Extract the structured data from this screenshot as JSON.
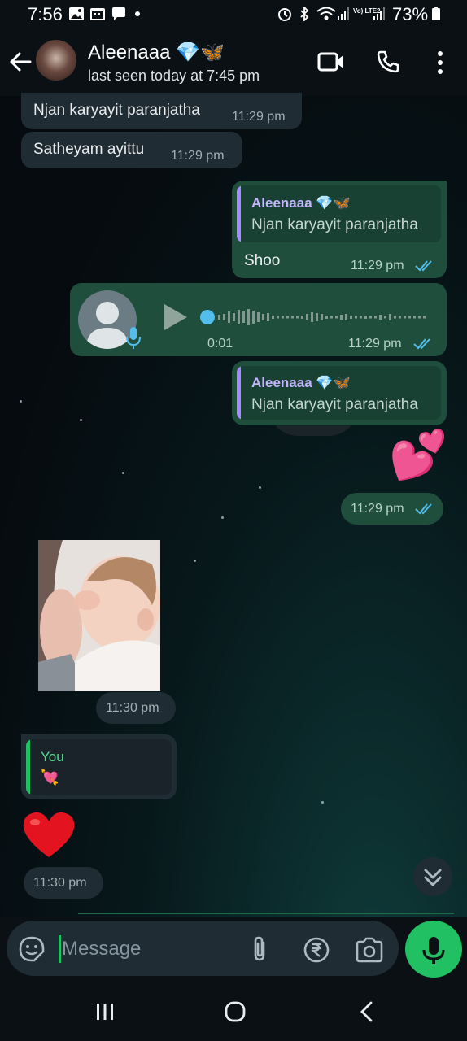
{
  "status_bar": {
    "time": "7:56",
    "network_label": "Vo) LTE2",
    "battery": "73%"
  },
  "header": {
    "contact_name": "Aleenaaa 💎🦋",
    "last_seen": "last seen today at 7:45 pm"
  },
  "messages": {
    "m1": {
      "text": "Njan karyayit paranjatha",
      "time": "11:29 pm"
    },
    "m2": {
      "text": "Satheyam ayittu",
      "time": "11:29 pm"
    },
    "m3": {
      "quote_author": "Aleenaaa 💎🦋",
      "quote_text": "Njan karyayit paranjatha",
      "text": "Shoo",
      "time": "11:29 pm"
    },
    "m4": {
      "duration": "0:01",
      "time": "11:29 pm"
    },
    "m5": {
      "quote_author": "Aleenaaa 💎🦋",
      "quote_text": "Njan karyayit paranjatha"
    },
    "m6": {
      "sticker": "💕",
      "time": "11:29 pm"
    },
    "m7": {
      "time": "11:30 pm"
    },
    "m8": {
      "quote_author": "You",
      "quote_text": "💘"
    },
    "m9": {
      "emoji": "❤️",
      "time": "11:30 pm"
    }
  },
  "input": {
    "placeholder": "Message"
  },
  "colors": {
    "accent": "#21c063",
    "outgoing_bubble": "#1f4e3d",
    "incoming_bubble": "#202c33",
    "read_ticks": "#53bdeb",
    "quote_bar_purple": "#a78bfa",
    "quote_bar_green": "#21c063"
  }
}
